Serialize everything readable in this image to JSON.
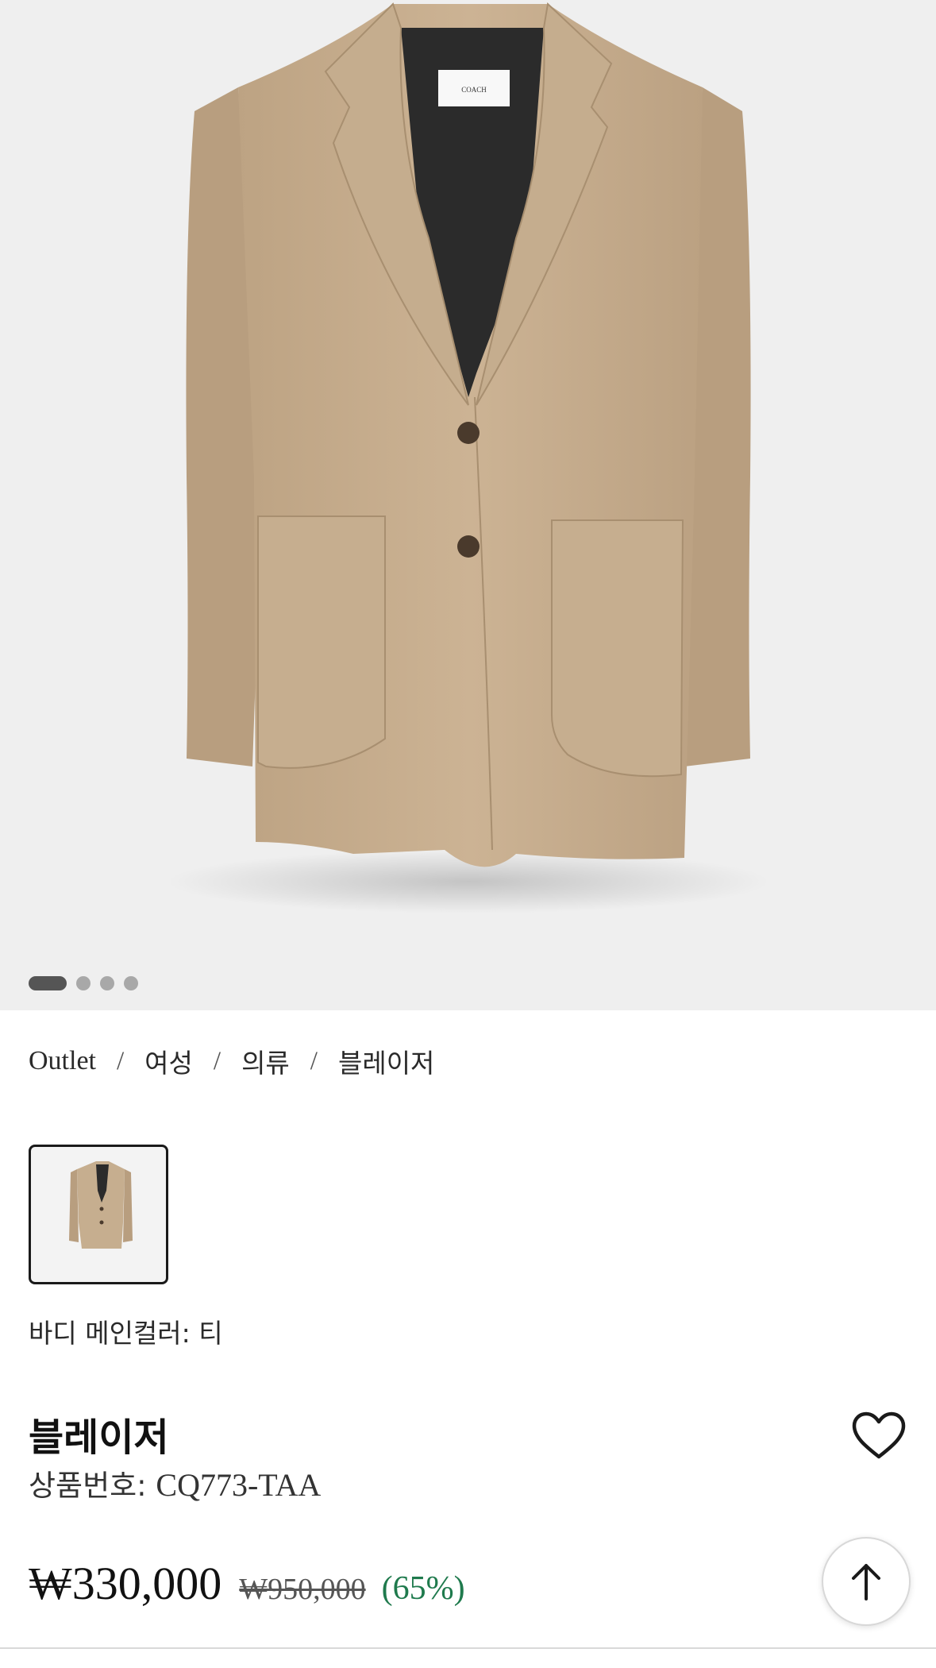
{
  "gallery": {
    "slide_count": 4,
    "active_slide": 1,
    "label_brand": "COACH"
  },
  "breadcrumb": {
    "items": [
      "Outlet",
      "여성",
      "의류",
      "블레이저"
    ],
    "separator": "/"
  },
  "color": {
    "label": "바디 메인컬러:",
    "value": "티"
  },
  "product": {
    "title": "블레이저",
    "sku_label": "상품번호:",
    "sku_value": "CQ773-TAA"
  },
  "price": {
    "current": "₩330,000",
    "original": "₩950,000",
    "discount": "(65%)"
  },
  "icons": {
    "wishlist": "heart-icon",
    "scroll_top": "arrow-up-icon"
  },
  "colors": {
    "hero_background": "#efefef",
    "jacket": "#c9b092",
    "discount": "#1f7a4d"
  }
}
